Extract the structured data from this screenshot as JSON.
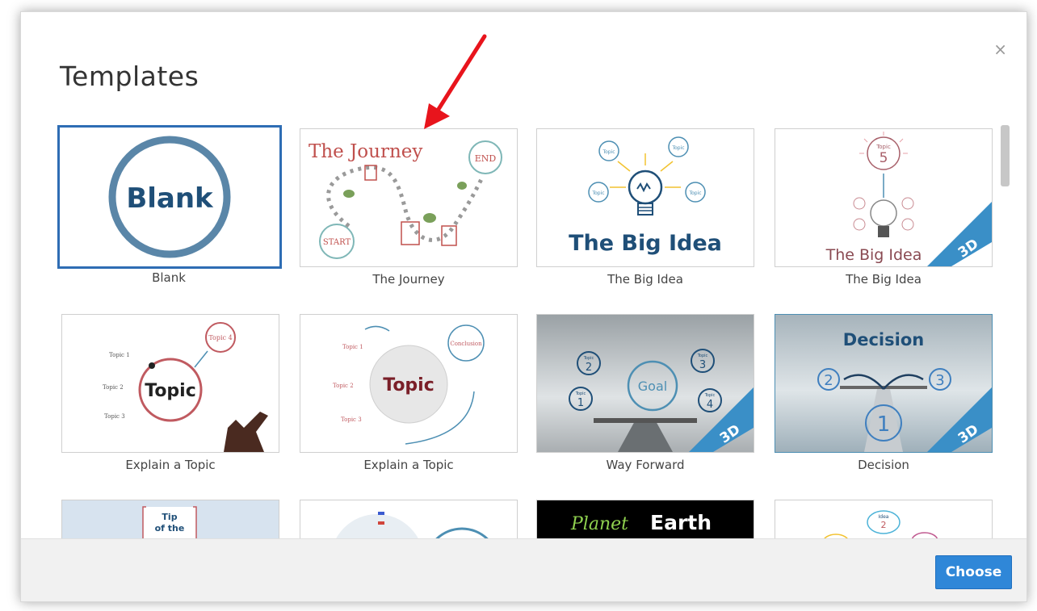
{
  "dialog": {
    "title": "Templates",
    "close_glyph": "×",
    "choose_label": "Choose"
  },
  "templates": [
    {
      "caption": "Blank",
      "thumb_text": "Blank",
      "selected": true
    },
    {
      "caption": "The Journey",
      "thumb_title": "The Journey",
      "start_label": "START",
      "end_label": "END"
    },
    {
      "caption": "The Big Idea",
      "thumb_title": "The Big Idea",
      "topic_label": "Topic"
    },
    {
      "caption": "The Big Idea",
      "thumb_title": "The Big Idea",
      "topic_label": "Topic",
      "topic_number": "5",
      "ribbon": "3D"
    },
    {
      "caption": "Explain a Topic",
      "center_label": "Topic",
      "topic_4": "Topic 4",
      "topic_1": "Topic 1",
      "topic_2": "Topic 2",
      "topic_3": "Topic 3"
    },
    {
      "caption": "Explain a Topic",
      "center_label": "Topic",
      "conclusion": "Conclusion",
      "topic_1": "Topic 1",
      "topic_2": "Topic 2",
      "topic_3": "Topic 3"
    },
    {
      "caption": "Way Forward",
      "goal_label": "Goal",
      "topic_label": "Topic",
      "numbers": [
        "2",
        "3",
        "1",
        "4"
      ],
      "ribbon": "3D"
    },
    {
      "caption": "Decision",
      "thumb_title": "Decision",
      "numbers": [
        "2",
        "3",
        "1"
      ],
      "ribbon": "3D"
    },
    {
      "caption": "",
      "tip_line1": "Tip",
      "tip_line2": "of the"
    },
    {
      "caption": ""
    },
    {
      "caption": "",
      "planet": "Planet",
      "earth": "Earth"
    },
    {
      "caption": "",
      "idea_label": "Idea",
      "idea_number": "2"
    }
  ],
  "colors": {
    "accent": "#2f87d8",
    "selected_border": "#2e6db4",
    "annotation_arrow": "#e8141c",
    "ribbon": "#3a8fc7"
  },
  "icons": [
    "close-icon",
    "arrow-annotation",
    "lightbulb-icon"
  ]
}
